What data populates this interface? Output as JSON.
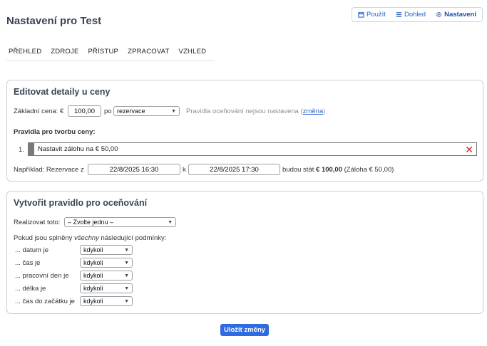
{
  "page": {
    "title": "Nastavení pro Test"
  },
  "top_nav": {
    "items": [
      {
        "label": "Použít",
        "icon": "calendar-icon"
      },
      {
        "label": "Dohled",
        "icon": "list-icon"
      },
      {
        "label": "Nastavení",
        "icon": "gear-icon",
        "active": true
      }
    ]
  },
  "tabs": [
    "PŘEHLED",
    "ZDROJE",
    "PŘÍSTUP",
    "ZPRACOVAT",
    "VZHLED"
  ],
  "edit_price": {
    "title": "Editovat detaily u ceny",
    "base_price_label": "Základní cena: €",
    "base_price_value": "100,00",
    "per_label": "po",
    "per_value": "rezervace",
    "no_rules_text": "Pravidla oceňování nejsou nastavena (",
    "change_link": "změna",
    "no_rules_close": ")",
    "rules_heading": "Pravidla pro tvorbu ceny:",
    "rules": [
      {
        "number": "1.",
        "text": "Nastavit zálohu na € 50,00"
      }
    ],
    "example_label": "Například: Rezervace z",
    "example_from": "22/8/2025 16:30",
    "example_to_label": "k",
    "example_to": "22/8/2025 17:30",
    "example_cost_label": "budou stát",
    "example_cost_value": "€ 100,00",
    "example_deposit": "(Záloha € 50,00)"
  },
  "create_rule": {
    "title": "Vytvořit pravidlo pro oceňování",
    "action_label": "Realizovat toto:",
    "action_value": "– Zvolte jednu –",
    "conditions_prefix": "Pokud jsou splněny",
    "conditions_emph": "všechny",
    "conditions_suffix": "následující podmínky:",
    "conditions": [
      {
        "label": "... datum je",
        "value": "kdykoli"
      },
      {
        "label": "... čas je",
        "value": "kdykoli"
      },
      {
        "label": "... pracovní den je",
        "value": "kdykoli"
      },
      {
        "label": "... délka je",
        "value": "kdykoli"
      },
      {
        "label": "... čas do začátku je",
        "value": "kdykoli"
      }
    ]
  },
  "save_label": "Uložit změny"
}
